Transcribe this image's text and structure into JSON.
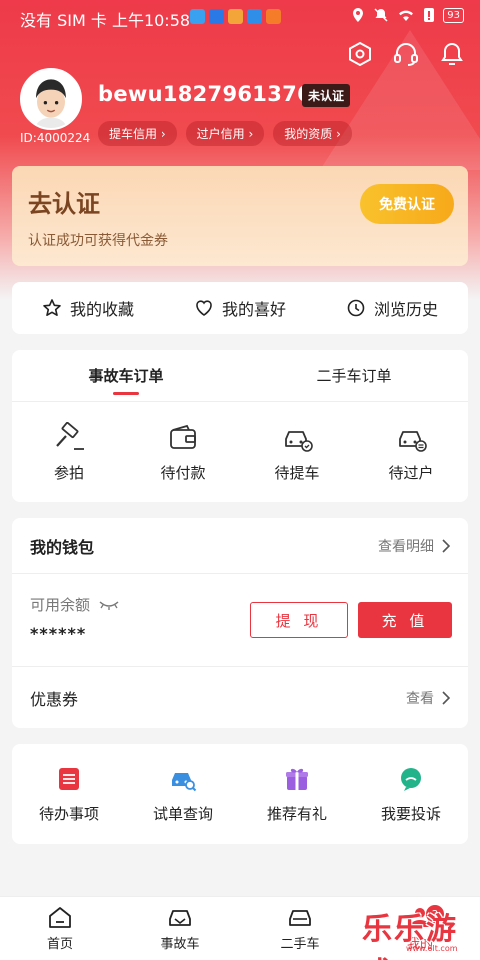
{
  "status_bar": {
    "text": "没有 SIM 卡 上午10:58",
    "battery": "93",
    "app_icons": [
      "#3aa0f0",
      "#2b79e6",
      "#f3a53a",
      "#2f8ee8",
      "#f57d2a"
    ]
  },
  "header": {
    "icons": [
      "settings-icon",
      "headset-icon",
      "bell-icon"
    ],
    "username": "bewu18279613765",
    "verify_badge": "未认证",
    "user_id": "ID:4000224",
    "chips": [
      "提车信用 ›",
      "过户信用 ›",
      "我的资质 ›"
    ]
  },
  "verify_card": {
    "title": "去认证",
    "subtitle": "认证成功可获得代金券",
    "button": "免费认证"
  },
  "quick_links": [
    {
      "label": "我的收藏",
      "icon": "star-icon"
    },
    {
      "label": "我的喜好",
      "icon": "heart-icon"
    },
    {
      "label": "浏览历史",
      "icon": "clock-icon"
    }
  ],
  "orders": {
    "tabs": [
      "事故车订单",
      "二手车订单"
    ],
    "active_tab": 0,
    "items": [
      {
        "label": "参拍",
        "icon": "auction-hammer-icon"
      },
      {
        "label": "待付款",
        "icon": "wallet-icon"
      },
      {
        "label": "待提车",
        "icon": "car-check-icon"
      },
      {
        "label": "待过户",
        "icon": "car-transfer-icon"
      }
    ]
  },
  "wallet": {
    "title": "我的钱包",
    "detail_link": "查看明细",
    "balance_label": "可用余额",
    "balance_value": "******",
    "withdraw": "提 现",
    "topup": "充 值",
    "coupon_label": "优惠券",
    "coupon_view": "查看"
  },
  "services": [
    {
      "label": "待办事项",
      "icon": "todo-list-icon",
      "color": "#e8353f"
    },
    {
      "label": "试单查询",
      "icon": "car-search-icon",
      "color": "#3b8fe0"
    },
    {
      "label": "推荐有礼",
      "icon": "gift-icon",
      "color": "#9b5ee0"
    },
    {
      "label": "我要投诉",
      "icon": "chat-bubble-icon",
      "color": "#22b38a"
    }
  ],
  "tabbar": {
    "items": [
      "首页",
      "事故车",
      "二手车",
      "我的"
    ],
    "active": 3,
    "badge": "2"
  },
  "watermark": {
    "text": "乐乐游戏",
    "url": "www.6lt.com"
  },
  "colors": {
    "accent": "#e8353f",
    "header_red": "#ee3a4a",
    "gold": "#f7a91a"
  }
}
